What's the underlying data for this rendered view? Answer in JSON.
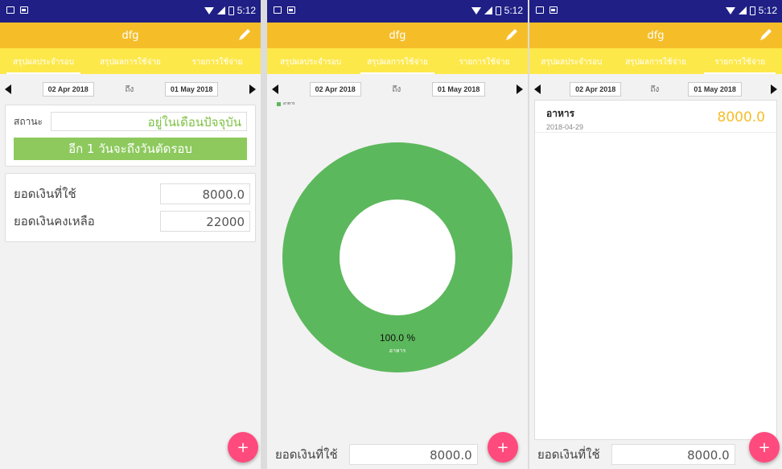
{
  "status_bar": {
    "time": "5:12"
  },
  "app": {
    "title": "dfg",
    "edit_icon": "pencil-icon"
  },
  "tabs": [
    {
      "label": "สรุปผลประจำรอบ"
    },
    {
      "label": "สรุปผลการใช้จ่าย"
    },
    {
      "label": "รายการใช้จ่าย"
    }
  ],
  "date_range": {
    "from": "02 Apr 2018",
    "to_label": "ถึง",
    "to": "01 May 2018"
  },
  "summary": {
    "status_label": "สถานะ",
    "status_value": "อยู่ในเดือนปัจจุบัน",
    "countdown": "อีก 1 วันจะถึงวันตัดรอบ",
    "spent_label": "ยอดเงินที่ใช้",
    "spent_value": "8000.0",
    "remaining_label": "ยอดเงินคงเหลือ",
    "remaining_value": "22000"
  },
  "chart": {
    "legend": "อาหาร",
    "center_percent": "100.0 %",
    "center_label": "อาหาร"
  },
  "chart_data": {
    "type": "pie",
    "categories": [
      "อาหาร"
    ],
    "values": [
      100.0
    ],
    "colors": [
      "#5cb85c"
    ]
  },
  "bottom": {
    "spent_label": "ยอดเงินที่ใช้",
    "spent_value": "8000.0"
  },
  "expenses": [
    {
      "title": "อาหาร",
      "date": "2018-04-29",
      "amount": "8000.0"
    }
  ],
  "fab": {
    "icon": "+"
  },
  "colors": {
    "appbar": "#f5be29",
    "tabs": "#fde84a",
    "status_bar": "#1f1f86",
    "fab": "#ff4a7d",
    "accent_green": "#8dc95d"
  }
}
